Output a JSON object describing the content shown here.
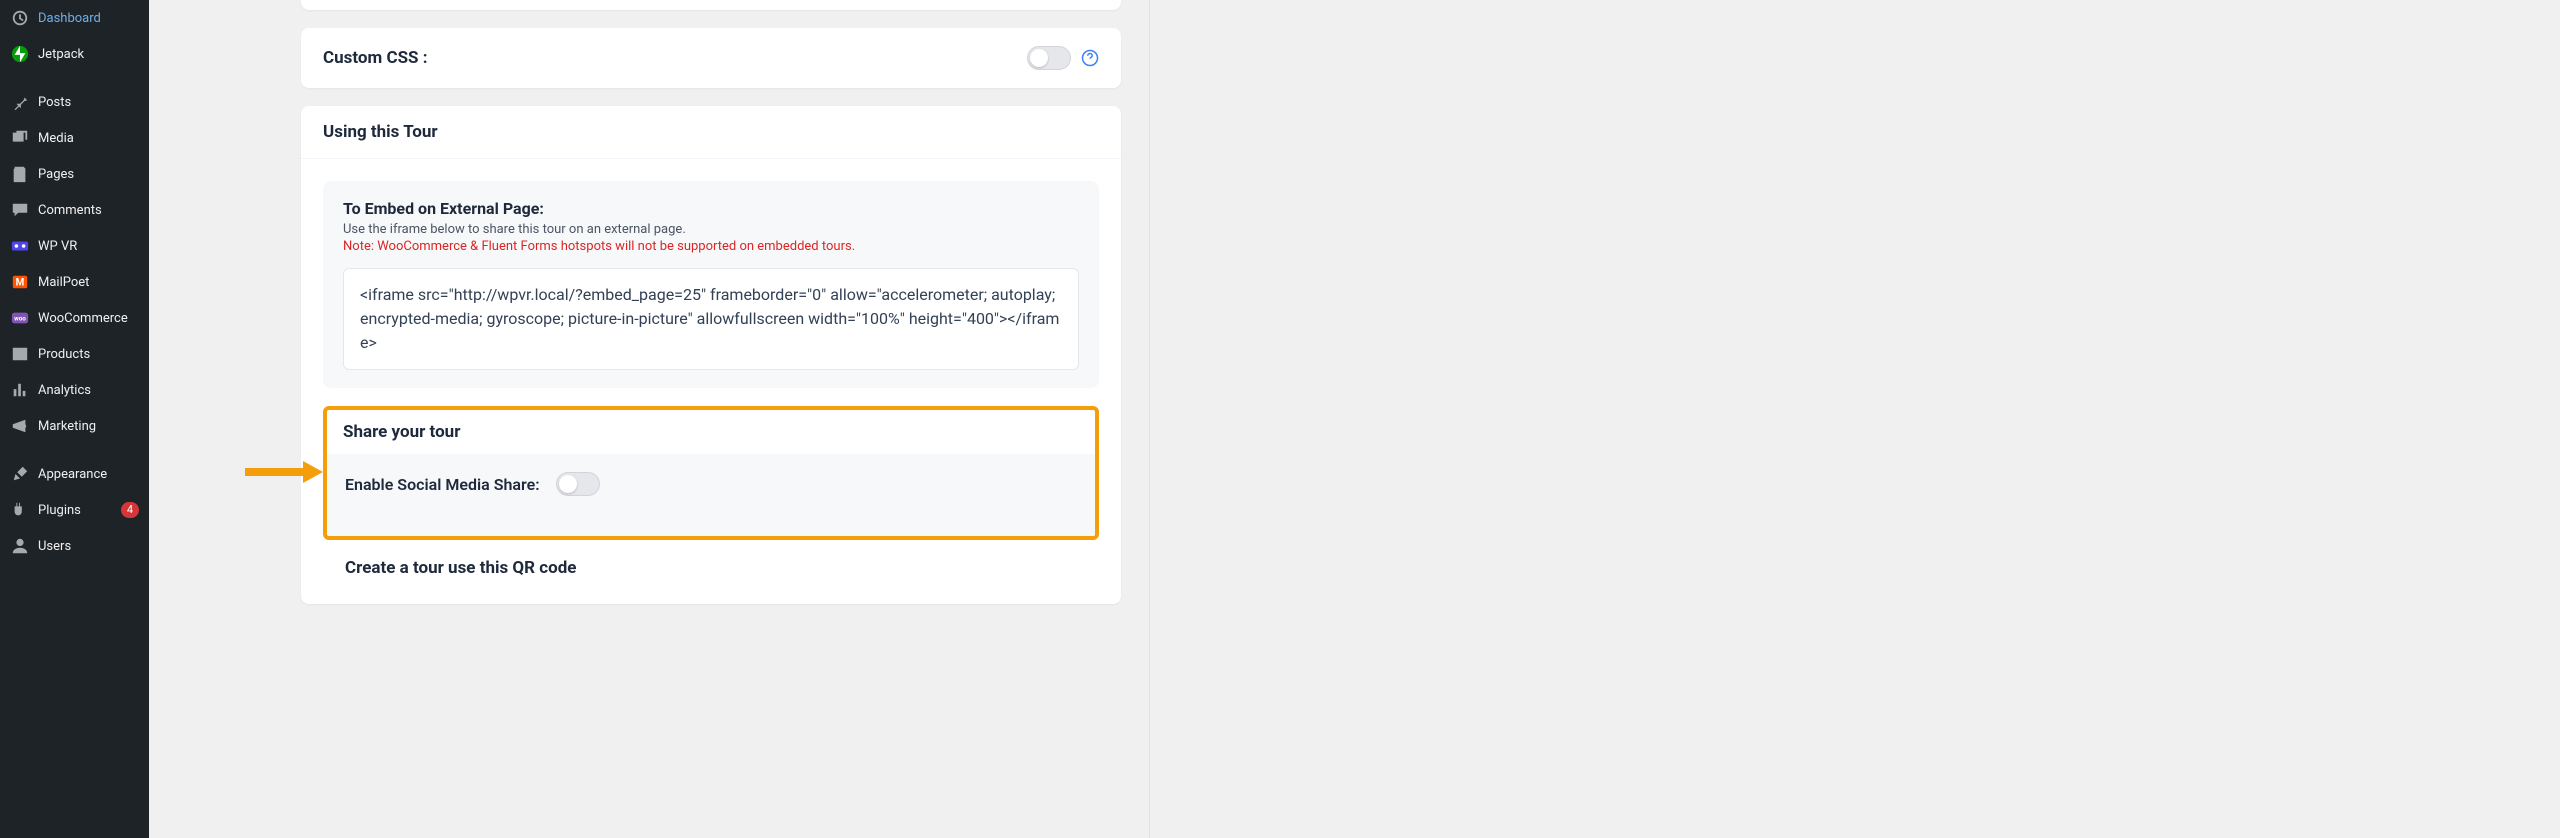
{
  "sidebar": {
    "items": [
      {
        "label": "Dashboard"
      },
      {
        "label": "Jetpack"
      },
      {
        "label": "Posts"
      },
      {
        "label": "Media"
      },
      {
        "label": "Pages"
      },
      {
        "label": "Comments"
      },
      {
        "label": "WP VR"
      },
      {
        "label": "MailPoet"
      },
      {
        "label": "WooCommerce"
      },
      {
        "label": "Products"
      },
      {
        "label": "Analytics"
      },
      {
        "label": "Marketing"
      },
      {
        "label": "Appearance"
      },
      {
        "label": "Plugins",
        "badge": "4"
      },
      {
        "label": "Users"
      }
    ]
  },
  "custom_css": {
    "label": "Custom CSS :"
  },
  "using_tour": {
    "heading": "Using this Tour",
    "embed_title": "To Embed on External Page:",
    "embed_sub": "Use the iframe below to share this tour on an external page.",
    "embed_note": "Note: WooCommerce & Fluent Forms hotspots will not be supported on embedded tours.",
    "iframe_code": "<iframe src=\"http://wpvr.local/?embed_page=25\" frameborder=\"0\" allow=\"accelerometer; autoplay; encrypted-media; gyroscope; picture-in-picture\" allowfullscreen width=\"100%\" height=\"400\"></iframe>"
  },
  "share": {
    "heading": "Share your tour",
    "label": "Enable Social Media Share:"
  },
  "qr": {
    "heading": "Create a tour use this QR code"
  }
}
